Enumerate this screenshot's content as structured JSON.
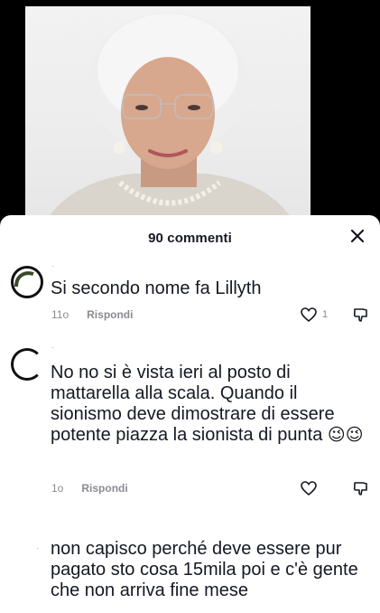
{
  "sheet": {
    "title": "90 commenti"
  },
  "comments": [
    {
      "username": "·",
      "text": "Si secondo nome fa Lillyth",
      "age": "11o",
      "reply_label": "Rispondi",
      "likes": "1"
    },
    {
      "username": "·",
      "text": "No no si è vista ieri al posto di mattarella alla scala. Quando il sionismo deve dimostrare di essere potente piazza la sionista di punta",
      "emoji": "😉😉",
      "age": "1o",
      "reply_label": "Rispondi",
      "likes": ""
    },
    {
      "username": "·",
      "text": "non capisco perché deve essere pur pagato sto cosa 15mila poi e c'è gente che non arriva fine mese"
    }
  ],
  "icons": {
    "close": "close-icon",
    "like": "heart-icon",
    "dislike": "thumbs-down-icon"
  },
  "colors": {
    "text": "#161823",
    "muted": "#8a8b91",
    "background": "#ffffff"
  }
}
